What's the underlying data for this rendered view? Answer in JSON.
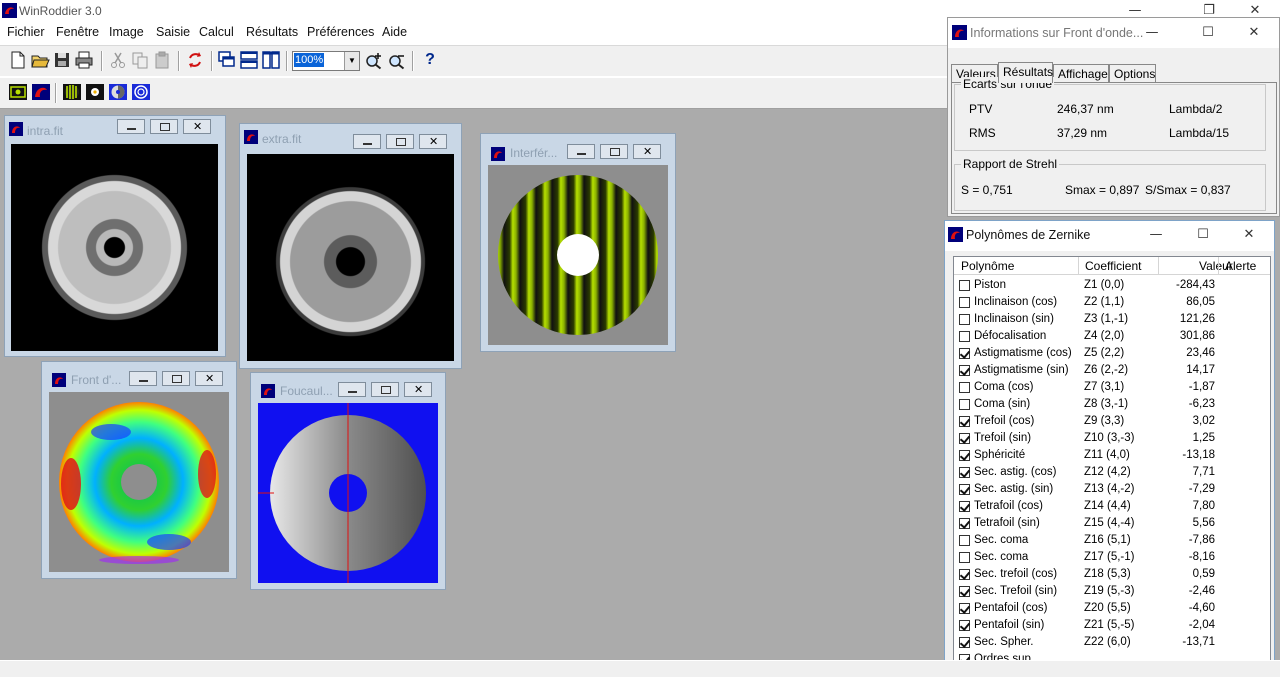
{
  "app": {
    "title": "WinRoddier 3.0"
  },
  "menu": [
    "Fichier",
    "Fenêtre",
    "Image",
    "Saisie",
    "Calcul",
    "Résultats",
    "Préférences",
    "Aide"
  ],
  "toolbar": {
    "zoom_value": "100%",
    "help_label": "?"
  },
  "mdi_windows": {
    "intra": {
      "title": "intra.fit"
    },
    "extra": {
      "title": "extra.fit"
    },
    "interfer": {
      "title": "Interfér..."
    },
    "front": {
      "title": "Front d'..."
    },
    "foucault": {
      "title": "Foucaul..."
    }
  },
  "info": {
    "title": "Informations sur Front d'onde...",
    "tabs": [
      "Valeurs",
      "Résultats",
      "Affichage",
      "Options"
    ],
    "active_tab": "Résultats",
    "ecarts": {
      "label": "Ecarts sur l'onde",
      "ptv_label": "PTV",
      "ptv_value": "246,37 nm",
      "ptv_lambda": "Lambda/2",
      "rms_label": "RMS",
      "rms_value": "37,29 nm",
      "rms_lambda": "Lambda/15"
    },
    "strehl": {
      "label": "Rapport de Strehl",
      "s": "S = 0,751",
      "smax": "Smax = 0,897",
      "ratio": "S/Smax = 0,837"
    }
  },
  "zernike": {
    "title": "Polynômes de Zernike",
    "columns": [
      "Polynôme",
      "Coefficient",
      "Valeur",
      "Alerte"
    ],
    "rows": [
      {
        "name": "Piston",
        "coef": "Z1 (0,0)",
        "value": "-284,43",
        "checked": false
      },
      {
        "name": "Inclinaison (cos)",
        "coef": "Z2 (1,1)",
        "value": "86,05",
        "checked": false
      },
      {
        "name": "Inclinaison (sin)",
        "coef": "Z3 (1,-1)",
        "value": "121,26",
        "checked": false
      },
      {
        "name": "Défocalisation",
        "coef": "Z4 (2,0)",
        "value": "301,86",
        "checked": false
      },
      {
        "name": "Astigmatisme (cos)",
        "coef": "Z5 (2,2)",
        "value": "23,46",
        "checked": true
      },
      {
        "name": "Astigmatisme (sin)",
        "coef": "Z6 (2,-2)",
        "value": "14,17",
        "checked": true
      },
      {
        "name": "Coma (cos)",
        "coef": "Z7 (3,1)",
        "value": "-1,87",
        "checked": false
      },
      {
        "name": "Coma (sin)",
        "coef": "Z8 (3,-1)",
        "value": "-6,23",
        "checked": false
      },
      {
        "name": "Trefoil (cos)",
        "coef": "Z9 (3,3)",
        "value": "3,02",
        "checked": true
      },
      {
        "name": "Trefoil (sin)",
        "coef": "Z10 (3,-3)",
        "value": "1,25",
        "checked": true
      },
      {
        "name": "Sphéricité",
        "coef": "Z11 (4,0)",
        "value": "-13,18",
        "checked": true
      },
      {
        "name": "Sec. astig. (cos)",
        "coef": "Z12 (4,2)",
        "value": "7,71",
        "checked": true
      },
      {
        "name": "Sec. astig. (sin)",
        "coef": "Z13 (4,-2)",
        "value": "-7,29",
        "checked": true
      },
      {
        "name": "Tetrafoil (cos)",
        "coef": "Z14 (4,4)",
        "value": "7,80",
        "checked": true
      },
      {
        "name": "Tetrafoil (sin)",
        "coef": "Z15 (4,-4)",
        "value": "5,56",
        "checked": true
      },
      {
        "name": "Sec. coma",
        "coef": "Z16 (5,1)",
        "value": "-7,86",
        "checked": false
      },
      {
        "name": "Sec. coma",
        "coef": "Z17 (5,-1)",
        "value": "-8,16",
        "checked": false
      },
      {
        "name": "Sec. trefoil (cos)",
        "coef": "Z18 (5,3)",
        "value": "0,59",
        "checked": true
      },
      {
        "name": "Sec. Trefoil (sin)",
        "coef": "Z19 (5,-3)",
        "value": "-2,46",
        "checked": true
      },
      {
        "name": "Pentafoil (cos)",
        "coef": "Z20 (5,5)",
        "value": "-4,60",
        "checked": true
      },
      {
        "name": "Pentafoil (sin)",
        "coef": "Z21 (5,-5)",
        "value": "-2,04",
        "checked": true
      },
      {
        "name": "Sec. Spher.",
        "coef": "Z22 (6,0)",
        "value": "-13,71",
        "checked": true
      },
      {
        "name": "Ordres sup.",
        "coef": "",
        "value": "",
        "checked": true
      }
    ]
  }
}
